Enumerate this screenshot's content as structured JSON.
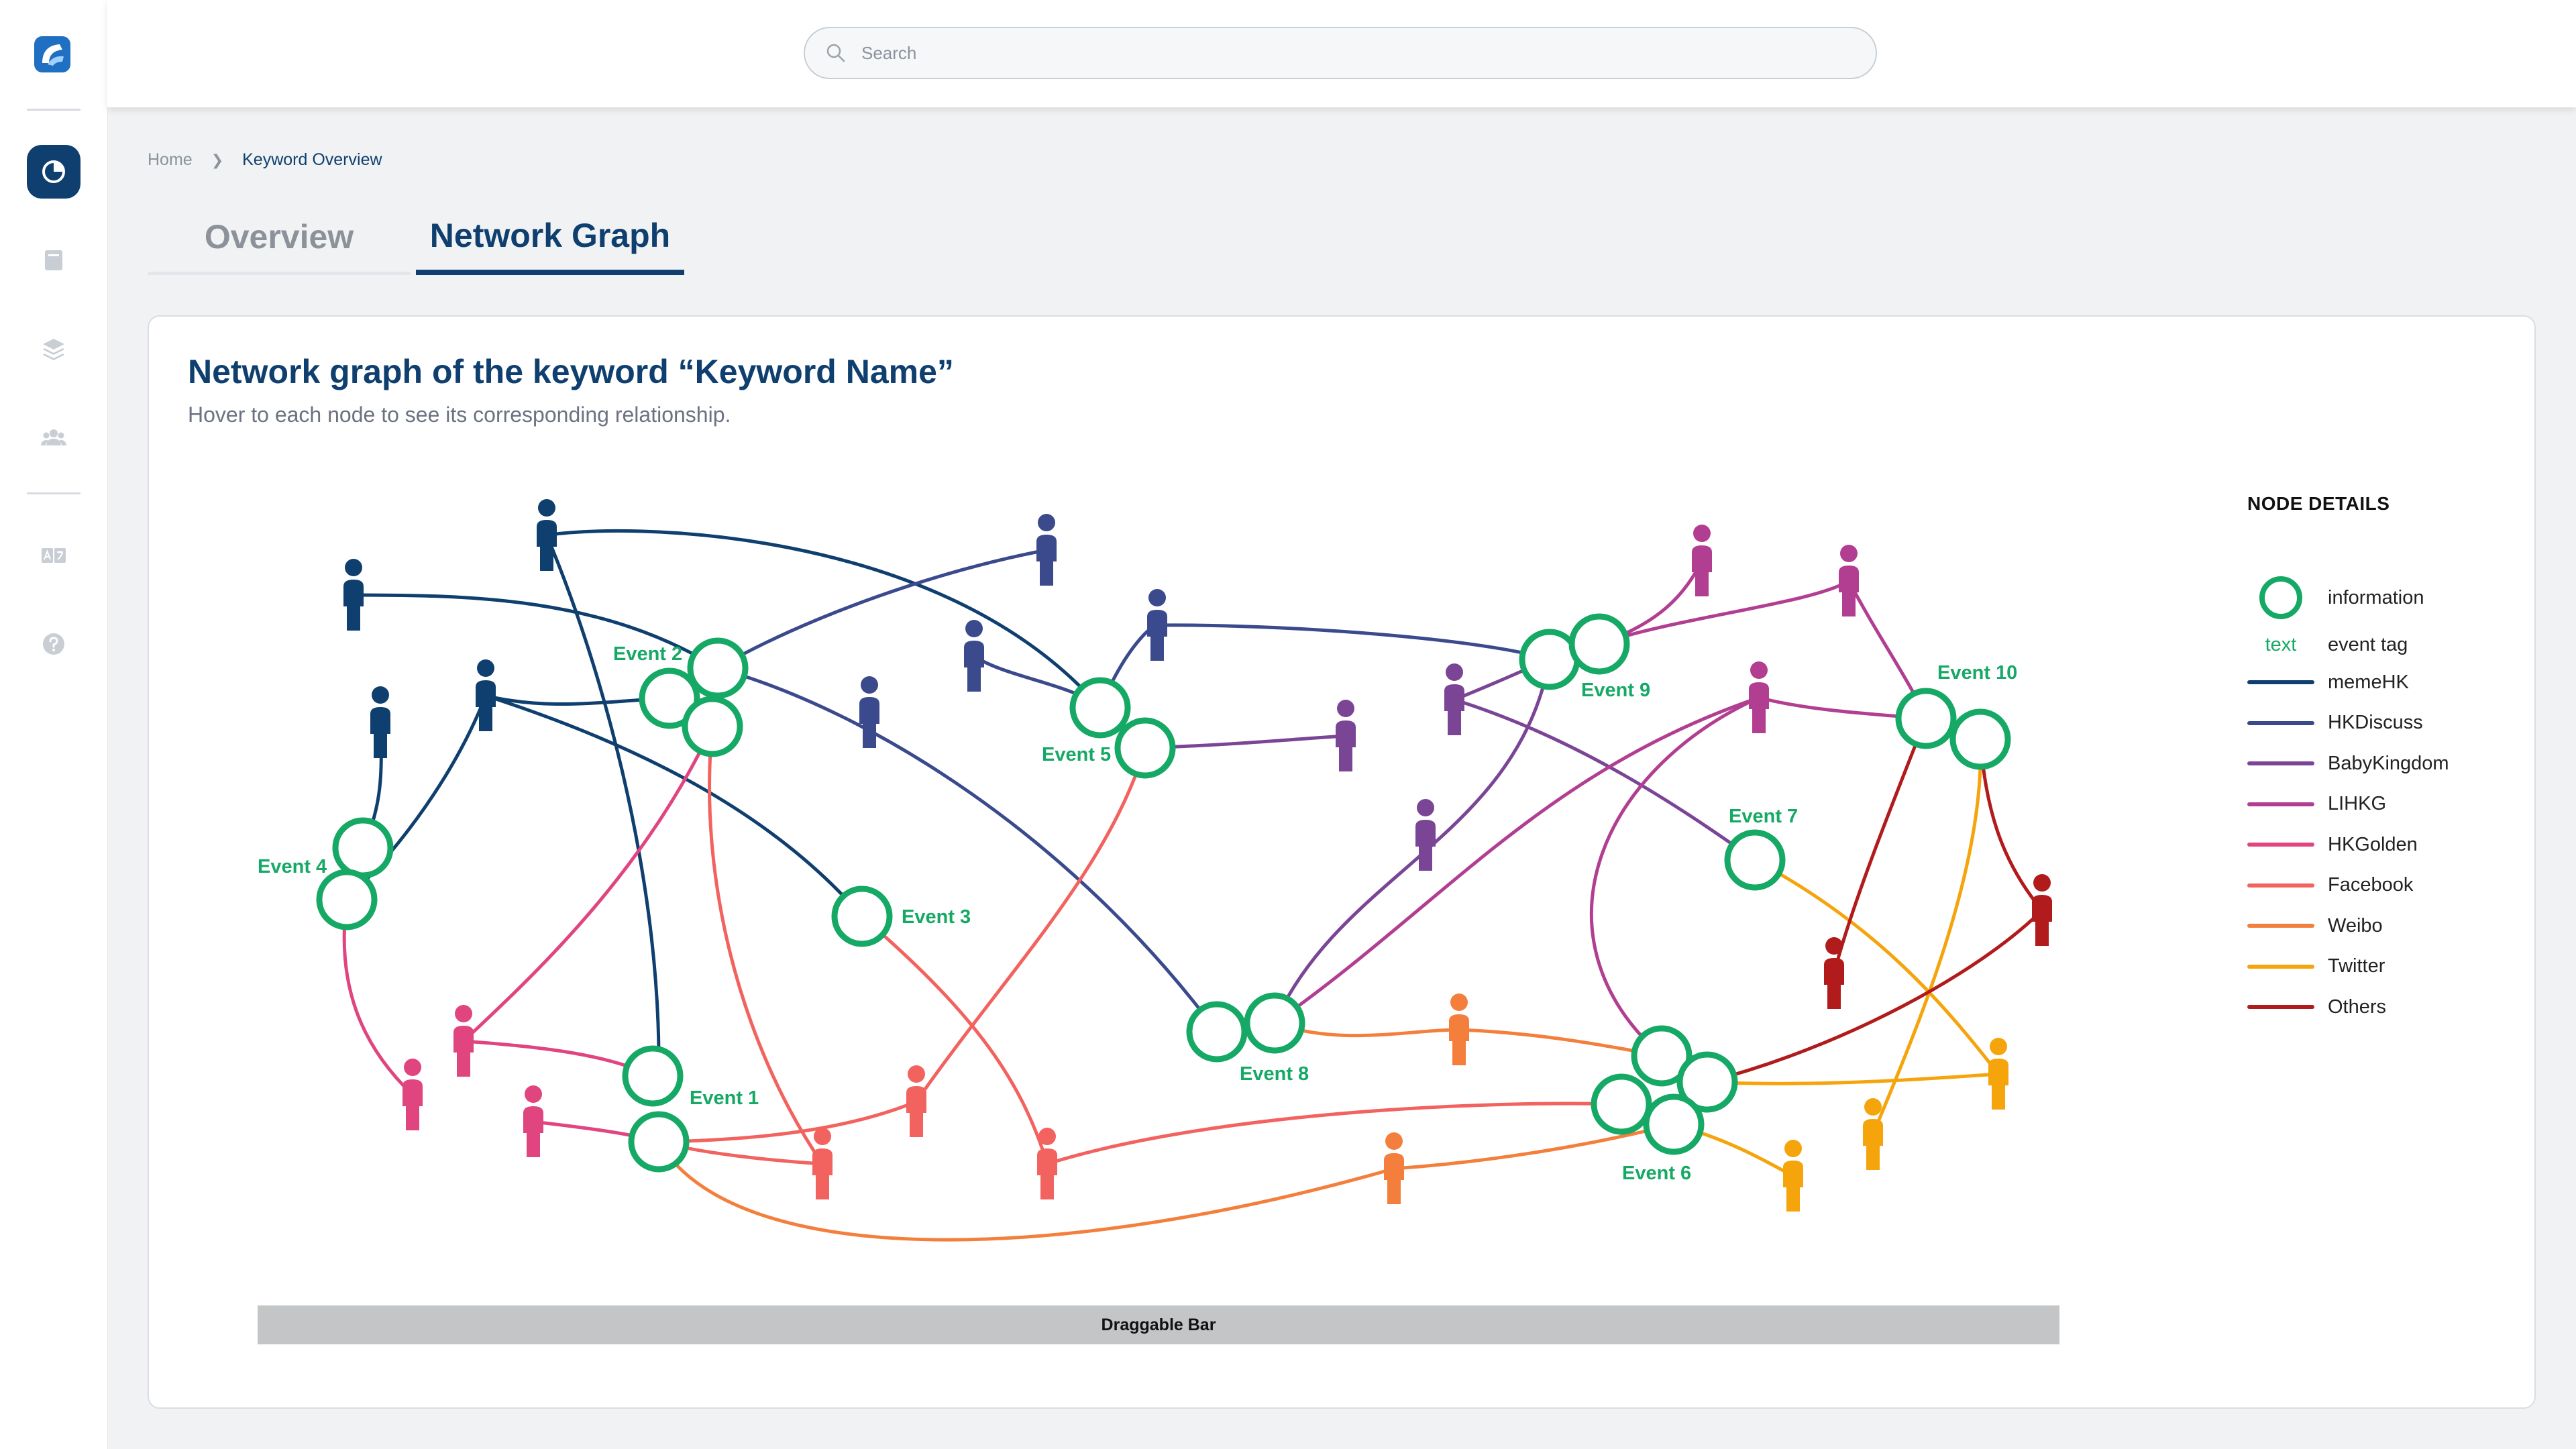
{
  "search": {
    "placeholder": "Search"
  },
  "breadcrumb": {
    "home": "Home",
    "current": "Keyword Overview"
  },
  "tabs": [
    {
      "label": "Overview",
      "active": false
    },
    {
      "label": "Network Graph",
      "active": true
    }
  ],
  "card": {
    "title": "Network graph of the keyword “Keyword Name”",
    "subtitle": "Hover to each node to see its corresponding relationship."
  },
  "sidebar": {
    "items": [
      {
        "icon": "pie-chart-icon",
        "active": true
      },
      {
        "icon": "book-icon",
        "active": false
      },
      {
        "icon": "layers-icon",
        "active": false
      },
      {
        "icon": "users-icon",
        "active": false
      },
      {
        "icon": "translate-icon",
        "active": false
      },
      {
        "icon": "help-icon",
        "active": false
      }
    ]
  },
  "draggable_bar": {
    "label": "Draggable Bar"
  },
  "legend": {
    "title": "NODE DETAILS",
    "info_label": "information",
    "event_mark": "text",
    "event_label": "event tag",
    "series": [
      {
        "name": "memeHK",
        "color": "#0f3f6e"
      },
      {
        "name": "HKDiscuss",
        "color": "#3a4a8c"
      },
      {
        "name": "BabyKingdom",
        "color": "#7b4596"
      },
      {
        "name": "LIHKG",
        "color": "#b23e92"
      },
      {
        "name": "HKGolden",
        "color": "#e0457f"
      },
      {
        "name": "Facebook",
        "color": "#f2625e"
      },
      {
        "name": "Weibo",
        "color": "#f47f3c"
      },
      {
        "name": "Twitter",
        "color": "#f5a40c"
      },
      {
        "name": "Others",
        "color": "#b11b1b"
      }
    ]
  },
  "graph": {
    "event_color": "#16a865",
    "events": [
      {
        "label": "Event 1"
      },
      {
        "label": "Event 2"
      },
      {
        "label": "Event 3"
      },
      {
        "label": "Event 4"
      },
      {
        "label": "Event 5"
      },
      {
        "label": "Event 6"
      },
      {
        "label": "Event 7"
      },
      {
        "label": "Event 8"
      },
      {
        "label": "Event 9"
      },
      {
        "label": "Event 10"
      }
    ]
  }
}
